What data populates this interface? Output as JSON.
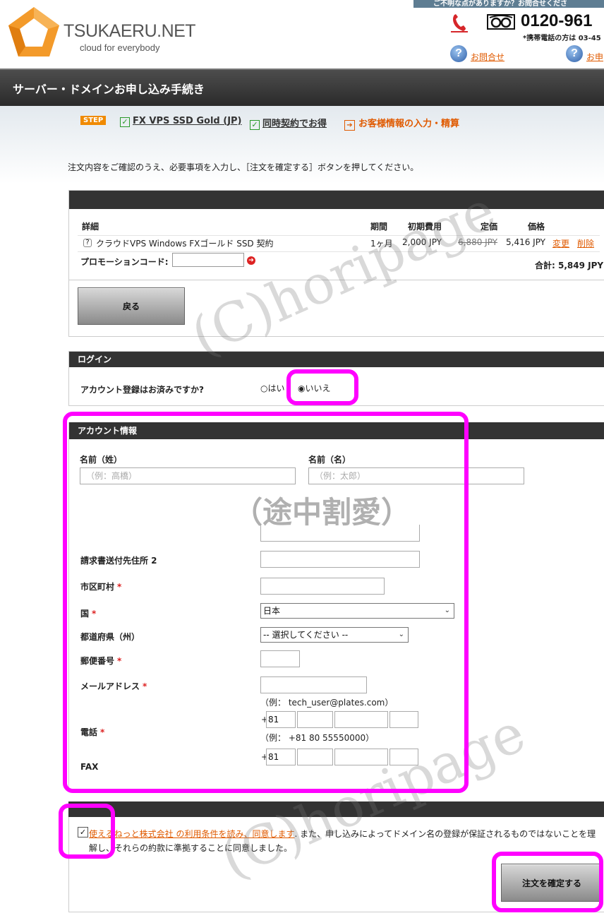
{
  "header": {
    "brand_name": "TSUKAERU.NET",
    "brand_tagline": "cloud for everybody",
    "top_notice": "ご不明な点がありますか？お問合せくださ",
    "phone_number": "0120-961",
    "phone_note": "*携帯電話の方は 03-45",
    "contact_link": "お問合せ",
    "apply_link": "お申"
  },
  "page": {
    "title": "サーバー・ドメインお申し込み手続き",
    "instruction": "注文内容をご確認のうえ、必要事項を入力し、［注文を確定する］ボタンを押してください。"
  },
  "steps": {
    "badge": "STEP",
    "items": [
      {
        "label": "FX VPS SSD Gold (JP)",
        "state": "done"
      },
      {
        "label": "同時契約でお得",
        "state": "done"
      },
      {
        "label": "お客様情報の入力・精算",
        "state": "current"
      }
    ]
  },
  "cart": {
    "headers": {
      "detail": "詳細",
      "period": "期間",
      "setup": "初期費用",
      "list_price": "定価",
      "price": "価格"
    },
    "row": {
      "name": "クラウドVPS Windows FXゴールド SSD 契約",
      "period": "1ヶ月",
      "setup": "2,000 JPY",
      "list_price": "6,880 JPY",
      "price": "5,416 JPY",
      "change": "変更",
      "delete": "削除"
    },
    "promo_label": "プロモーションコード:",
    "promo_value": "",
    "total": "合計: 5,849 JPY",
    "back_button": "戻る"
  },
  "login": {
    "heading": "ログイン",
    "question": "アカウント登録はお済みですか?",
    "option_yes": "はい",
    "option_no": "いいえ",
    "selected": "いいえ"
  },
  "account": {
    "heading": "アカウント情報",
    "last_name_label": "名前（姓）",
    "last_name_placeholder": "（例：高橋）",
    "first_name_label": "名前（名）",
    "first_name_placeholder": "（例：太郎）",
    "omitted_note": "（途中割愛）",
    "address2_label": "請求書送付先住所 2",
    "city_label": "市区町村",
    "country_label": "国",
    "country_value": "日本",
    "prefecture_label": "都道府県（州）",
    "prefecture_value": "-- 選択してください --",
    "zip_label": "郵便番号",
    "email_label": "メールアドレス",
    "email_hint": "（例： tech_user@plates.com）",
    "phone_label": "電話",
    "phone_plus": "+",
    "phone_code": "81",
    "phone_hint": "（例： +81 80 55550000）",
    "fax_label": "FAX",
    "fax_plus": "+",
    "fax_code": "81",
    "required_mark": "*"
  },
  "terms": {
    "link_text": "使えるねっと株式会社 の利用条件を読み、同意します",
    "rest_text": ". また、申し込みによってドメイン名の登録が保証されるものではないことを理解し、それらの約款に準拠することに同意しました。",
    "checked": true
  },
  "confirm_button": "注文を確定する",
  "watermark": "(C)horipage",
  "colors": {
    "accent": "#e05a00",
    "highlight": "#ff00ff",
    "dark_bar": "#333333",
    "step_badge": "#f08a00"
  }
}
